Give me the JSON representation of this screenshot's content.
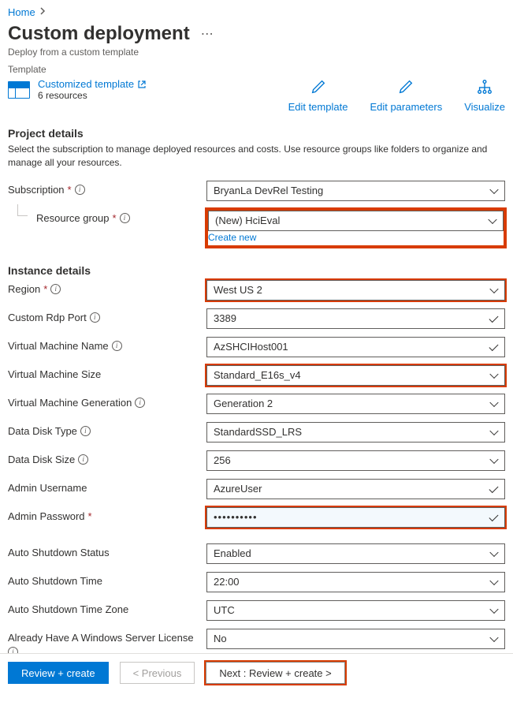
{
  "breadcrumb": {
    "home": "Home"
  },
  "page": {
    "title": "Custom deployment",
    "subtitle": "Deploy from a custom template",
    "template_label": "Template"
  },
  "template_card": {
    "link": "Customized template",
    "resources": "6 resources"
  },
  "actions": {
    "edit_template": "Edit template",
    "edit_parameters": "Edit parameters",
    "visualize": "Visualize"
  },
  "project": {
    "heading": "Project details",
    "desc": "Select the subscription to manage deployed resources and costs. Use resource groups like folders to organize and manage all your resources."
  },
  "instance": {
    "heading": "Instance details"
  },
  "labels": {
    "subscription": "Subscription",
    "resource_group": "Resource group",
    "region": "Region",
    "custom_rdp": "Custom Rdp Port",
    "vm_name": "Virtual Machine Name",
    "vm_size": "Virtual Machine Size",
    "vm_gen": "Virtual Machine Generation",
    "disk_type": "Data Disk Type",
    "disk_size": "Data Disk Size",
    "admin_user": "Admin Username",
    "admin_pass": "Admin Password",
    "auto_status": "Auto Shutdown Status",
    "auto_time": "Auto Shutdown Time",
    "auto_tz": "Auto Shutdown Time Zone",
    "win_license": "Already Have A Windows Server License",
    "create_new": "Create new"
  },
  "values": {
    "subscription": "BryanLa DevRel Testing",
    "resource_group": "(New) HciEval",
    "region": "West US 2",
    "custom_rdp": "3389",
    "vm_name": "AzSHCIHost001",
    "vm_size": "Standard_E16s_v4",
    "vm_gen": "Generation 2",
    "disk_type": "StandardSSD_LRS",
    "disk_size": "256",
    "admin_user": "AzureUser",
    "admin_pass": "••••••••••",
    "auto_status": "Enabled",
    "auto_time": "22:00",
    "auto_tz": "UTC",
    "win_license": "No"
  },
  "footer": {
    "review": "Review + create",
    "previous": "< Previous",
    "next": "Next : Review + create >"
  }
}
